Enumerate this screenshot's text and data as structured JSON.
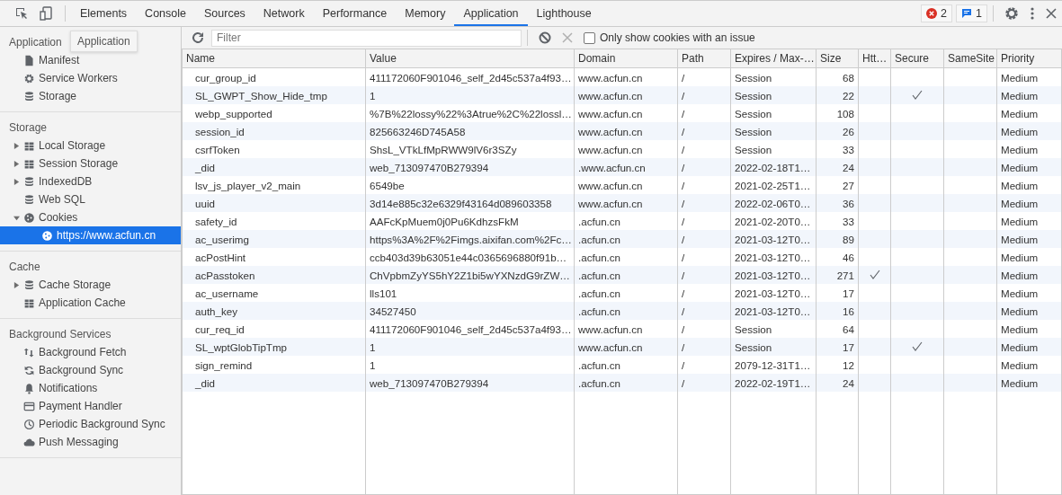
{
  "toolbar": {
    "tabs": [
      {
        "label": "Elements",
        "selected": false
      },
      {
        "label": "Console",
        "selected": false
      },
      {
        "label": "Sources",
        "selected": false
      },
      {
        "label": "Network",
        "selected": false
      },
      {
        "label": "Performance",
        "selected": false
      },
      {
        "label": "Memory",
        "selected": false
      },
      {
        "label": "Application",
        "selected": true
      },
      {
        "label": "Lighthouse",
        "selected": false
      }
    ],
    "errors_badge": "2",
    "messages_badge": "1"
  },
  "sidebar": {
    "tooltip": "Application",
    "sections": [
      {
        "title": "Application",
        "items": [
          {
            "label": "Manifest"
          },
          {
            "label": "Service Workers"
          },
          {
            "label": "Storage"
          }
        ]
      },
      {
        "title": "Storage",
        "items": [
          {
            "label": "Local Storage",
            "expanded": false,
            "selected": false
          },
          {
            "label": "Session Storage",
            "expanded": false,
            "selected": false
          },
          {
            "label": "IndexedDB",
            "expanded": false,
            "selected": false
          },
          {
            "label": "Web SQL",
            "selected": false
          },
          {
            "label": "Cookies",
            "expanded": true,
            "selected": false,
            "children": [
              {
                "label": "https://www.acfun.cn",
                "selected": true
              }
            ]
          }
        ]
      },
      {
        "title": "Cache",
        "items": [
          {
            "label": "Cache Storage",
            "expanded": false,
            "selected": false
          },
          {
            "label": "Application Cache",
            "selected": false
          }
        ]
      },
      {
        "title": "Background Services",
        "items": [
          {
            "label": "Background Fetch"
          },
          {
            "label": "Background Sync"
          },
          {
            "label": "Notifications"
          },
          {
            "label": "Payment Handler"
          },
          {
            "label": "Periodic Background Sync"
          },
          {
            "label": "Push Messaging"
          }
        ]
      }
    ]
  },
  "cookie_toolbar": {
    "filter_placeholder": "Filter",
    "issue_checkbox": {
      "label": "Only show cookies with an issue",
      "checked": false
    }
  },
  "table": {
    "columns": [
      "Name",
      "Value",
      "Domain",
      "Path",
      "Expires / Max-…",
      "Size",
      "Htt…",
      "Secure",
      "SameSite",
      "Priority"
    ],
    "rows": [
      {
        "name": "cur_group_id",
        "value": "411172060F901046_self_2d45c537a4f93…",
        "domain": "www.acfun.cn",
        "path": "/",
        "expires": "Session",
        "size": "68",
        "http_only": false,
        "secure": false,
        "priority": "Medium"
      },
      {
        "name": "SL_GWPT_Show_Hide_tmp",
        "value": "1",
        "domain": "www.acfun.cn",
        "path": "/",
        "expires": "Session",
        "size": "22",
        "http_only": false,
        "secure": true,
        "priority": "Medium"
      },
      {
        "name": "webp_supported",
        "value": "%7B%22lossy%22%3Atrue%2C%22lossl…",
        "domain": "www.acfun.cn",
        "path": "/",
        "expires": "Session",
        "size": "108",
        "http_only": false,
        "secure": false,
        "priority": "Medium"
      },
      {
        "name": "session_id",
        "value": "825663246D745A58",
        "domain": "www.acfun.cn",
        "path": "/",
        "expires": "Session",
        "size": "26",
        "http_only": false,
        "secure": false,
        "priority": "Medium"
      },
      {
        "name": "csrfToken",
        "value": "ShsL_VTkLfMpRWW9lV6r3SZy",
        "domain": "www.acfun.cn",
        "path": "/",
        "expires": "Session",
        "size": "33",
        "http_only": false,
        "secure": false,
        "priority": "Medium"
      },
      {
        "name": "_did",
        "value": "web_713097470B279394",
        "domain": ".www.acfun.cn",
        "path": "/",
        "expires": "2022-02-18T1…",
        "size": "24",
        "http_only": false,
        "secure": false,
        "priority": "Medium"
      },
      {
        "name": "lsv_js_player_v2_main",
        "value": "6549be",
        "domain": "www.acfun.cn",
        "path": "/",
        "expires": "2021-02-25T1…",
        "size": "27",
        "http_only": false,
        "secure": false,
        "priority": "Medium"
      },
      {
        "name": "uuid",
        "value": "3d14e885c32e6329f43164d089603358",
        "domain": "www.acfun.cn",
        "path": "/",
        "expires": "2022-02-06T0…",
        "size": "36",
        "http_only": false,
        "secure": false,
        "priority": "Medium"
      },
      {
        "name": "safety_id",
        "value": "AAFcKpMuem0j0Pu6KdhzsFkM",
        "domain": ".acfun.cn",
        "path": "/",
        "expires": "2021-02-20T0…",
        "size": "33",
        "http_only": false,
        "secure": false,
        "priority": "Medium"
      },
      {
        "name": "ac_userimg",
        "value": "https%3A%2F%2Fimgs.aixifan.com%2Fc…",
        "domain": ".acfun.cn",
        "path": "/",
        "expires": "2021-03-12T0…",
        "size": "89",
        "http_only": false,
        "secure": false,
        "priority": "Medium"
      },
      {
        "name": "acPostHint",
        "value": "ccb403d39b63051e44c0365696880f91b…",
        "domain": ".acfun.cn",
        "path": "/",
        "expires": "2021-03-12T0…",
        "size": "46",
        "http_only": false,
        "secure": false,
        "priority": "Medium"
      },
      {
        "name": "acPasstoken",
        "value": "ChVpbmZyYS5hY2Z1bi5wYXNzdG9rZW…",
        "domain": ".acfun.cn",
        "path": "/",
        "expires": "2021-03-12T0…",
        "size": "271",
        "http_only": true,
        "secure": false,
        "priority": "Medium"
      },
      {
        "name": "ac_username",
        "value": "lls101",
        "domain": ".acfun.cn",
        "path": "/",
        "expires": "2021-03-12T0…",
        "size": "17",
        "http_only": false,
        "secure": false,
        "priority": "Medium"
      },
      {
        "name": "auth_key",
        "value": "34527450",
        "domain": ".acfun.cn",
        "path": "/",
        "expires": "2021-03-12T0…",
        "size": "16",
        "http_only": false,
        "secure": false,
        "priority": "Medium"
      },
      {
        "name": "cur_req_id",
        "value": "411172060F901046_self_2d45c537a4f93…",
        "domain": "www.acfun.cn",
        "path": "/",
        "expires": "Session",
        "size": "64",
        "http_only": false,
        "secure": false,
        "priority": "Medium"
      },
      {
        "name": "SL_wptGlobTipTmp",
        "value": "1",
        "domain": "www.acfun.cn",
        "path": "/",
        "expires": "Session",
        "size": "17",
        "http_only": false,
        "secure": true,
        "priority": "Medium"
      },
      {
        "name": "sign_remind",
        "value": "1",
        "domain": ".acfun.cn",
        "path": "/",
        "expires": "2079-12-31T1…",
        "size": "12",
        "http_only": false,
        "secure": false,
        "priority": "Medium"
      },
      {
        "name": "_did",
        "value": "web_713097470B279394",
        "domain": ".acfun.cn",
        "path": "/",
        "expires": "2022-02-19T1…",
        "size": "24",
        "http_only": false,
        "secure": false,
        "priority": "Medium"
      }
    ]
  }
}
